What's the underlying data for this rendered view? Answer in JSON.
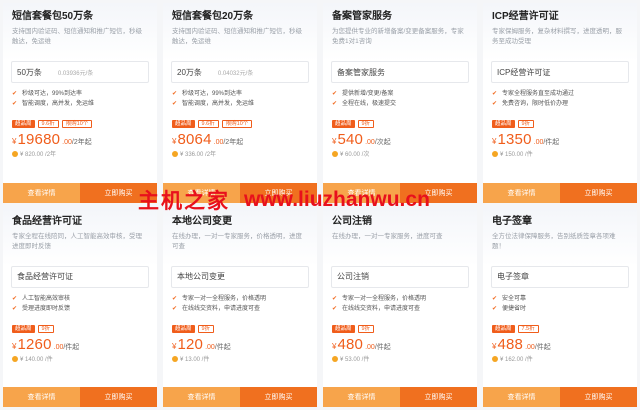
{
  "watermark": {
    "cn": "主机之家",
    "url": "www.liuzhanwu.cn"
  },
  "cards": [
    {
      "title": "短信套餐包50万条",
      "desc": "支持国内验证码、短信通知和推广短信，秒级触达，免运维",
      "spec": "50万条",
      "spec_unit": "0.03936元/条",
      "features": [
        "秒级可达，99%到达率",
        "智能调度，高并发，免运维"
      ],
      "tags": [
        "超品周",
        "9.6折",
        "限购10个"
      ],
      "price": "19680",
      "decimals": ".00",
      "per": "/2年起",
      "original": "¥ 820.00 /2年",
      "detail_label": "查看详情",
      "buy_label": "立即购买"
    },
    {
      "title": "短信套餐包20万条",
      "desc": "支持国内验证码、短信通知和推广短信，秒级触达，免运维",
      "spec": "20万条",
      "spec_unit": "0.04032元/条",
      "features": [
        "秒级可达，99%到达率",
        "智能调度，高并发，免运维"
      ],
      "tags": [
        "超品周",
        "9.6折",
        "限购10个"
      ],
      "price": "8064",
      "decimals": ".00",
      "per": "/2年起",
      "original": "¥ 336.00 /2年",
      "detail_label": "查看详情",
      "buy_label": "立即购买"
    },
    {
      "title": "备案管家服务",
      "desc": "为您提供专业的新增备案/变更备案服务，专家免费1对1咨询",
      "spec": "备案管家服务",
      "spec_unit": "",
      "features": [
        "提供新增/变更/备案",
        "全程在线，极速提交"
      ],
      "tags": [
        "超品周",
        "9折"
      ],
      "price": "540",
      "decimals": ".00",
      "per": "/次起",
      "original": "¥ 60.00 /次",
      "detail_label": "查看详情",
      "buy_label": "立即购买"
    },
    {
      "title": "ICP经营许可证",
      "desc": "专家保姆服务，复杂材料撰写，进度透明，服务至成功受理",
      "spec": "ICP经营许可证",
      "spec_unit": "",
      "features": [
        "专家全程服务直至成功通过",
        "免费咨询，限时低价办理"
      ],
      "tags": [
        "超品周",
        "9折"
      ],
      "price": "1350",
      "decimals": ".00",
      "per": "/件起",
      "original": "¥ 150.00 /件",
      "detail_label": "查看详情",
      "buy_label": "立即购买"
    },
    {
      "title": "食品经营许可证",
      "desc": "专家全程在线陪同，人工智能高效审核，受理进度即时反馈",
      "spec": "食品经营许可证",
      "spec_unit": "",
      "features": [
        "人工智能高效审核",
        "受理进度即时反馈"
      ],
      "tags": [
        "超品周",
        "9折"
      ],
      "price": "1260",
      "decimals": ".00",
      "per": "/件起",
      "original": "¥ 140.00 /件",
      "detail_label": "查看详情",
      "buy_label": "立即购买"
    },
    {
      "title": "本地公司变更",
      "desc": "在线办理，一对一专家服务，价格透明，进度可查",
      "spec": "本地公司变更",
      "spec_unit": "",
      "features": [
        "专家一对一全程服务，价格透明",
        "在线线交资料，申请进度可查"
      ],
      "tags": [
        "超品周",
        "9折"
      ],
      "price": "120",
      "decimals": ".00",
      "per": "/件起",
      "original": "¥ 13.00 /件",
      "detail_label": "查看详情",
      "buy_label": "立即购买"
    },
    {
      "title": "公司注销",
      "desc": "在线办理，一对一专家服务，进度可查",
      "spec": "公司注销",
      "spec_unit": "",
      "features": [
        "专家一对一全程服务，价格透明",
        "在线线交资料，申请进度可查"
      ],
      "tags": [
        "超品周",
        "9折"
      ],
      "price": "480",
      "decimals": ".00",
      "per": "/件起",
      "original": "¥ 53.00 /件",
      "detail_label": "查看详情",
      "buy_label": "立即购买"
    },
    {
      "title": "电子签章",
      "desc": "全方位法律保障服务，告别纸质签章各项难题！",
      "spec": "电子签章",
      "spec_unit": "",
      "features": [
        "安全可靠",
        "便捷省时"
      ],
      "tags": [
        "超品周",
        "7.5折"
      ],
      "price": "488",
      "decimals": ".00",
      "per": "/件起",
      "original": "¥ 162.00 /件",
      "detail_label": "查看详情",
      "buy_label": "立即购买"
    }
  ],
  "colors": {
    "accent": "#f05d1b",
    "detail_button": "#f7a44b",
    "buy_button": "#f0701f",
    "watermark": "#e8101c"
  }
}
